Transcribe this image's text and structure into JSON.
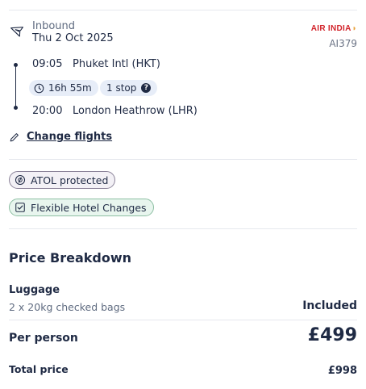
{
  "flight": {
    "direction": "Inbound",
    "date": "Thu 2 Oct 2025",
    "airline_logo_text": "AIR INDIA",
    "flight_number": "AI379",
    "departure": {
      "time": "09:05",
      "place": "Phuket Intl (HKT)"
    },
    "duration": "16h 55m",
    "stops": "1 stop",
    "arrival": {
      "time": "20:00",
      "place": "London Heathrow (LHR)"
    },
    "change_label": "Change flights"
  },
  "badges": {
    "atol": "ATOL protected",
    "flexible": "Flexible Hotel Changes"
  },
  "price": {
    "title": "Price Breakdown",
    "luggage_label": "Luggage",
    "luggage_detail": "2 x 20kg checked bags",
    "luggage_value": "Included",
    "per_person_label": "Per person",
    "per_person_value": "£499",
    "total_label": "Total price",
    "total_value": "£998"
  },
  "colors": {
    "text": "#1f2a44",
    "brand_red": "#d2232a",
    "pill_bg": "#e7edf8",
    "flex_badge_bg": "#e8f5ee"
  },
  "icons": [
    "plane-icon",
    "clock-icon",
    "help-icon",
    "pencil-icon",
    "atol-icon",
    "checkbox-icon"
  ]
}
